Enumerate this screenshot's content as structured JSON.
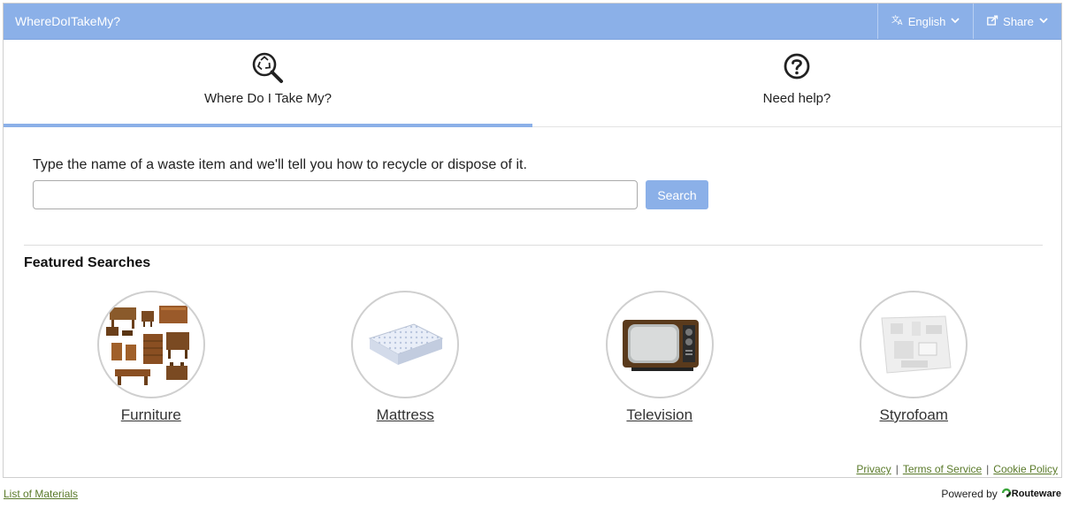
{
  "header": {
    "brand": "WhereDoITakeMy?",
    "language_label": "English",
    "share_label": "Share"
  },
  "tabs": [
    {
      "label": "Where Do I Take My?",
      "active": true
    },
    {
      "label": "Need help?",
      "active": false
    }
  ],
  "search": {
    "prompt": "Type the name of a waste item and we'll tell you how to recycle or dispose of it.",
    "value": "",
    "placeholder": "",
    "button_label": "Search"
  },
  "featured": {
    "title": "Featured Searches",
    "items": [
      {
        "label": "Furniture",
        "icon": "furniture-image"
      },
      {
        "label": "Mattress",
        "icon": "mattress-image"
      },
      {
        "label": "Television",
        "icon": "television-image"
      },
      {
        "label": "Styrofoam",
        "icon": "styrofoam-image"
      }
    ]
  },
  "frame_links": {
    "privacy": "Privacy",
    "terms": "Terms of Service",
    "cookie": "Cookie Policy",
    "separator": "|"
  },
  "footer": {
    "list_of_materials": "List of Materials",
    "powered_by": "Powered by",
    "powered_brand": "Routeware"
  },
  "colors": {
    "accent": "#8bb0e8",
    "link": "#5a7a2a"
  }
}
